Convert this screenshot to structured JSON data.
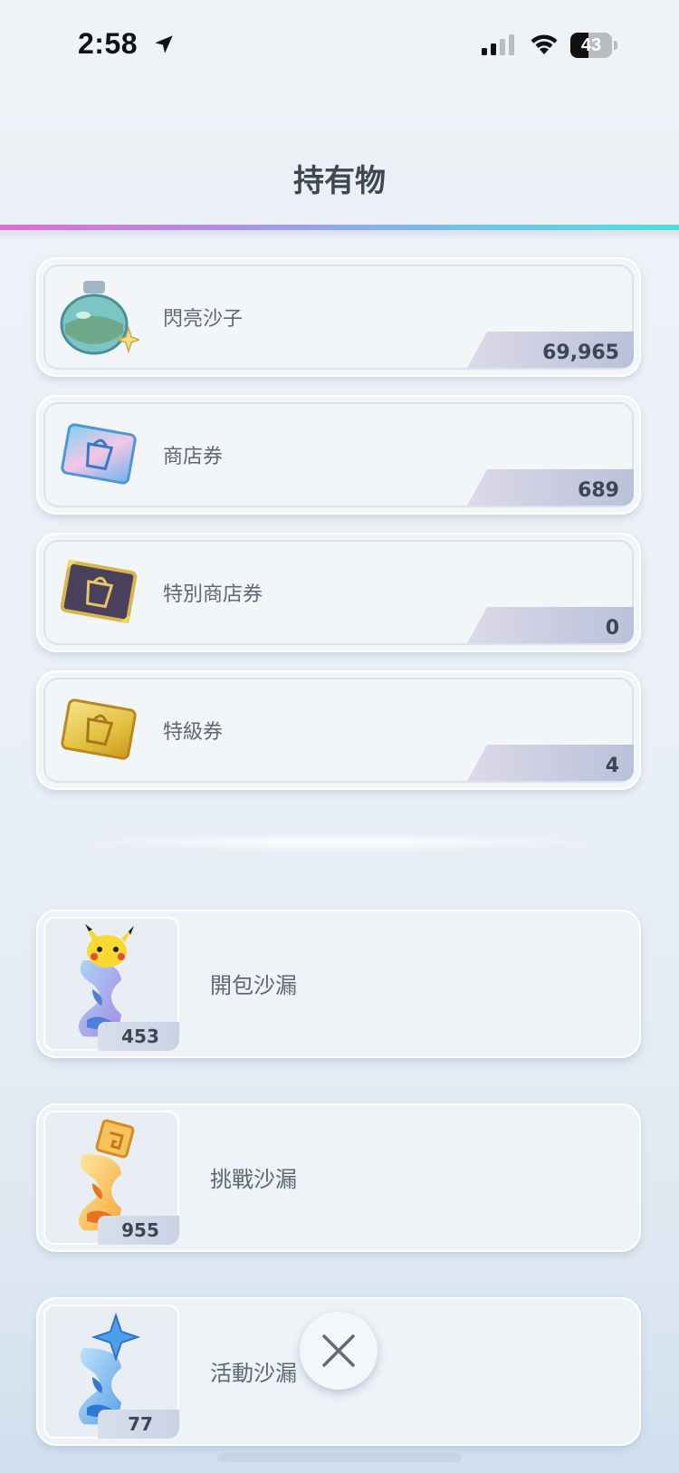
{
  "status_bar": {
    "time": "2:58",
    "battery": "43",
    "battery_level": 0.43
  },
  "header": {
    "title": "持有物"
  },
  "currencies": [
    {
      "label": "閃亮沙子",
      "amount": "69,965",
      "icon": "shiny-sand-jar-icon"
    },
    {
      "label": "商店券",
      "amount": "689",
      "icon": "shop-ticket-icon"
    },
    {
      "label": "特別商店券",
      "amount": "0",
      "icon": "special-shop-ticket-icon"
    },
    {
      "label": "特級券",
      "amount": "4",
      "icon": "premium-ticket-icon"
    }
  ],
  "hourglasses": [
    {
      "label": "開包沙漏",
      "count": "453",
      "icon": "pack-hourglass-icon"
    },
    {
      "label": "挑戰沙漏",
      "count": "955",
      "icon": "challenge-hourglass-icon"
    },
    {
      "label": "活動沙漏",
      "count": "77",
      "icon": "event-hourglass-icon"
    }
  ],
  "colors": {
    "accent_gradient": [
      "#e36bd0",
      "#7fb6f2",
      "#52ddd6"
    ],
    "text": "#5d6776",
    "amount_text": "#3d4654"
  },
  "close_icon": "close-icon"
}
